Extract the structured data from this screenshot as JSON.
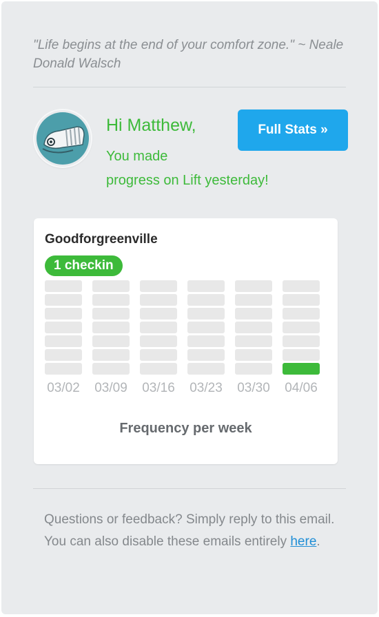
{
  "quote": {
    "text": "\"Life begins at the end of your comfort zone.\" ~ Neale Donald Walsch"
  },
  "greeting": {
    "title": "Hi Matthew,",
    "line1": "You made",
    "line2": "progress on Lift yesterday!"
  },
  "actions": {
    "full_stats_label": "Full Stats »"
  },
  "habit_card": {
    "name": "Goodforgreenville",
    "badge": "1 checkin",
    "footer_label": "Frequency per week"
  },
  "chart_data": {
    "type": "bar",
    "categories": [
      "03/02",
      "03/09",
      "03/16",
      "03/23",
      "03/30",
      "04/06"
    ],
    "values": [
      0,
      0,
      0,
      0,
      0,
      1
    ],
    "ylim": [
      0,
      7
    ],
    "title": "",
    "xlabel": "Frequency per week",
    "ylabel": "",
    "grid": false,
    "filled_color": "#3dba3a",
    "empty_color": "#e8e8e8"
  },
  "footer": {
    "text_before": "Questions or feedback? Simply reply to this email. You can also disable these emails entirely ",
    "link_label": "here",
    "text_after": "."
  },
  "colors": {
    "accent_green": "#3dba3a",
    "button_blue": "#1fa7ec",
    "background": "#e9ebed"
  },
  "icons": {
    "avatar": "whale-avatar-icon"
  }
}
